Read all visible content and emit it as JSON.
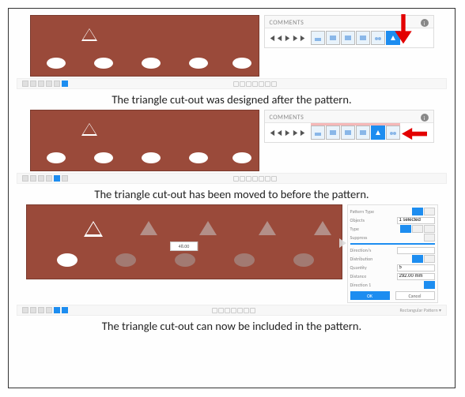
{
  "section1": {
    "caption": "The triangle cut-out was designed after the pattern.",
    "panel_title": "COMMENTS",
    "info_glyph": "i",
    "arrow_dir": "down",
    "selected_step_index": 5
  },
  "section2": {
    "caption": "The triangle cut-out has been moved to before the pattern.",
    "panel_title": "COMMENTS",
    "info_glyph": "i",
    "arrow_dir": "left",
    "selected_step_index": 4
  },
  "section3": {
    "caption": "The triangle cut-out can now be included in the pattern.",
    "center_label": "48.00",
    "props": {
      "pattern_type_label": "Pattern Type",
      "objects_label": "Objects",
      "objects_select": "1 selected",
      "type_label": "Type",
      "distribution_label": "Distribution",
      "suppress_label": "Suppress",
      "direction_label": "Direction/s",
      "quantity_label": "Quantity",
      "quantity_value": "5",
      "distance_label": "Distance",
      "distance_value": "292.00 mm",
      "direction1_label": "Direction 1",
      "direction1_active": true,
      "ok_label": "OK",
      "cancel_label": "Cancel"
    },
    "footer_right": "Rectangular Pattern ▾"
  },
  "timeline": {
    "step_count": 6
  }
}
